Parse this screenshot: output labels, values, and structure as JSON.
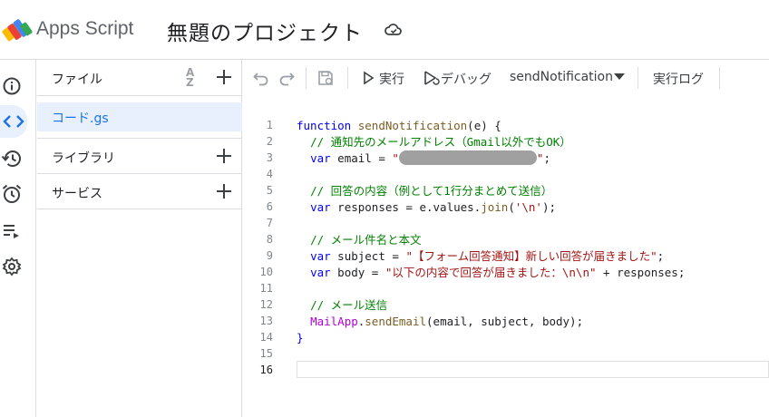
{
  "header": {
    "app_name": "Apps Script",
    "project_title": "無題のプロジェクト"
  },
  "files_panel": {
    "files_label": "ファイル",
    "sort_label_a": "A",
    "sort_label_z": "Z",
    "file_name": "コード.gs",
    "libraries_label": "ライブラリ",
    "services_label": "サービス"
  },
  "toolbar": {
    "run_label": "実行",
    "debug_label": "デバッグ",
    "function_name": "sendNotification",
    "log_label": "実行ログ"
  },
  "code": {
    "line_numbers": [
      "1",
      "2",
      "3",
      "4",
      "5",
      "6",
      "7",
      "8",
      "9",
      "10",
      "11",
      "12",
      "13",
      "14",
      "15",
      "16"
    ],
    "l1_kw": "function",
    "l1_fn": "sendNotification",
    "l1_rest": "(e) {",
    "l2_comment": "// 通知先のメールアドレス（Gmail以外でもOK）",
    "l3_kw": "var",
    "l3_rest": " email = ",
    "l3_q1": "\"",
    "l3_q2": "\"",
    "l3_end": ";",
    "l5_comment": "// 回答の内容（例として1行分まとめて送信）",
    "l6_kw": "var",
    "l6_rest": " responses = e.values.",
    "l6_fn": "join",
    "l6_open": "(",
    "l6_str": "'\\n'",
    "l6_end": ");",
    "l8_comment": "// メール件名と本文",
    "l9_kw": "var",
    "l9_rest": " subject = ",
    "l9_str": "\"【フォーム回答通知】新しい回答が届きました\"",
    "l9_end": ";",
    "l10_kw": "var",
    "l10_rest": " body = ",
    "l10_str": "\"以下の内容で回答が届きました：\\n\\n\"",
    "l10_end": " + responses;",
    "l12_comment": "// メール送信",
    "l13_cls": "MailApp",
    "l13_dot": ".",
    "l13_fn": "sendEmail",
    "l13_rest": "(email, subject, body);",
    "l14": "}"
  }
}
